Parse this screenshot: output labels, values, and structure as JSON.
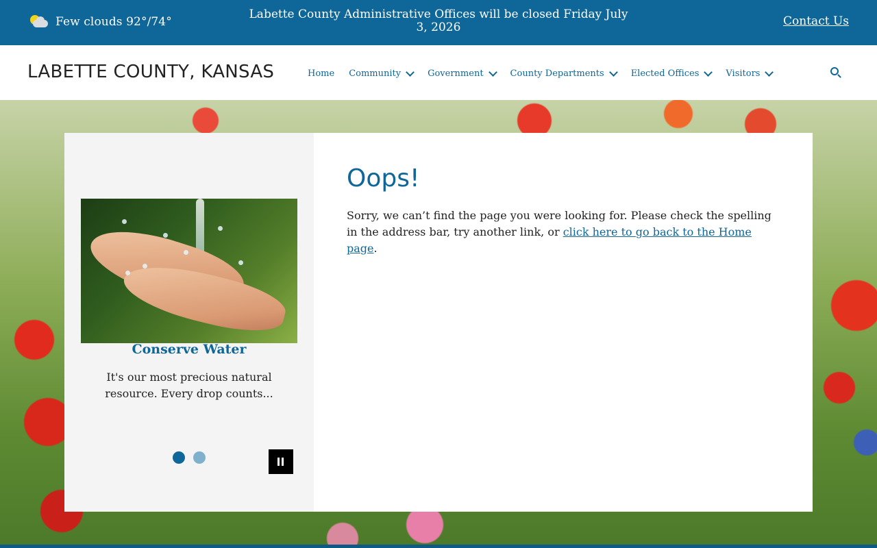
{
  "topbar": {
    "weather_text": "Few clouds 92°/74°",
    "weather_icon": "partly-cloudy-icon",
    "alert_text": "Labette County Administrative Offices will be closed Friday July 3, 2026",
    "contact_label": "Contact Us",
    "bg_color": "#0e6699"
  },
  "header": {
    "site_title": "LABETTE COUNTY, KANSAS",
    "nav": [
      {
        "label": "Home",
        "dropdown": false
      },
      {
        "label": "Community",
        "dropdown": true
      },
      {
        "label": "Government",
        "dropdown": true
      },
      {
        "label": "County Departments",
        "dropdown": true
      },
      {
        "label": "Elected Offices",
        "dropdown": true
      },
      {
        "label": "Visitors",
        "dropdown": true
      }
    ],
    "search_icon": "search-icon"
  },
  "slider": {
    "slide_title": "Conserve Water",
    "slide_text": "It's our most precious natural resource.  Every drop counts...",
    "slide_count": 2,
    "active_slide": 1,
    "pause_icon": "pause-icon"
  },
  "main": {
    "heading": "Oops!",
    "message_before": "Sorry, we can’t find the page you were looking for. Please check the spelling in the address bar, try another link, or ",
    "home_link": "click here to go back to the Home page",
    "message_after": "."
  },
  "colors": {
    "accent": "#0e6699",
    "dot_inactive": "#7fb1cc"
  }
}
